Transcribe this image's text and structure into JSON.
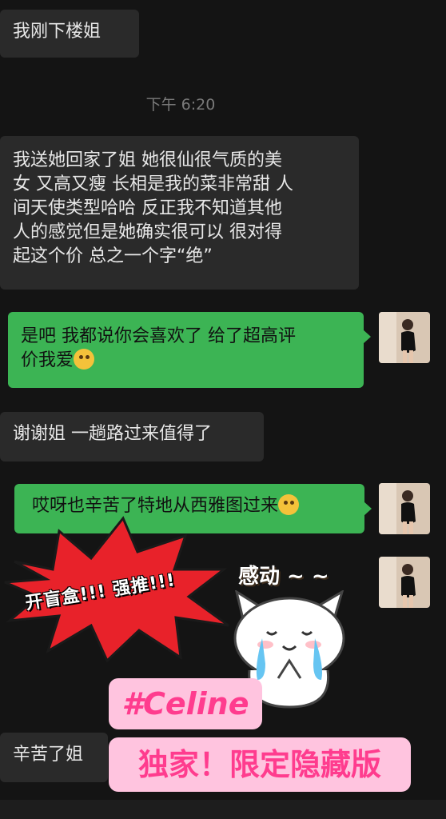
{
  "messages": {
    "m1": "我刚下楼姐",
    "time": "下午 6:20",
    "m2_line1": "我送她回家了姐 她很仙很气质的美",
    "m2_line2": "女 又高又瘦 长相是我的菜非常甜 人",
    "m2_line3": "间天使类型哈哈 反正我不知道其他",
    "m2_line4": "人的感觉但是她确实很可以 很对得",
    "m2_line5": "起这个价 总之一个字“绝”",
    "m3_line1": "是吧 我都说你会喜欢了 给了超高评",
    "m3_line2": "价我爱",
    "m4": "谢谢姐 一趟路过来值得了",
    "m5": "哎呀也辛苦了特地从西雅图过来",
    "m6": "辛苦了姐"
  },
  "overlay": {
    "burst_text": "开盲盒!!! 强推!!!",
    "cat_caption": "感动 ~ ~",
    "tag_name": "#Celine",
    "tag_exclusive": "独家！限定隐藏版"
  },
  "icons": {
    "m3_emoji": "thinking-face-emoji",
    "m5_emoji": "crying-laughing-emoji"
  },
  "colors": {
    "background": "#141414",
    "incoming_bubble": "#2a2a2a",
    "outgoing_bubble": "#3cb454",
    "burst_red": "#e8222a",
    "tag_pink_bg": "#ffc4df",
    "tag_pink_text": "#ff3c8e"
  }
}
